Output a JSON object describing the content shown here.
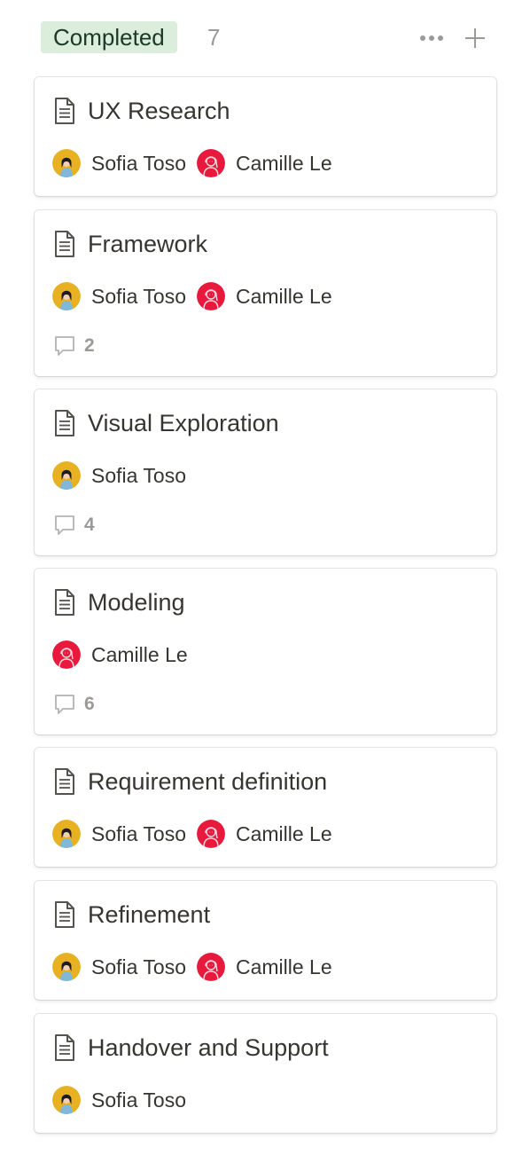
{
  "column": {
    "status_label": "Completed",
    "count": "7",
    "colors": {
      "pill_bg": "#dbeddb",
      "pill_text": "#1c3829",
      "muted": "#9b9a97"
    },
    "icons": {
      "more": "more-horizontal-icon",
      "add": "plus-icon"
    }
  },
  "people": {
    "sofia": {
      "name": "Sofia Toso",
      "avatar_color": "#e8b122"
    },
    "camille": {
      "name": "Camille Le",
      "avatar_color": "#e8193c"
    }
  },
  "cards": [
    {
      "title": "UX Research",
      "assignees": [
        "Sofia Toso",
        "Camille Le"
      ]
    },
    {
      "title": "Framework",
      "assignees": [
        "Sofia Toso",
        "Camille Le"
      ],
      "comments": "2"
    },
    {
      "title": "Visual Exploration",
      "assignees": [
        "Sofia Toso"
      ],
      "comments": "4"
    },
    {
      "title": "Modeling",
      "assignees": [
        "Camille Le"
      ],
      "comments": "6"
    },
    {
      "title": "Requirement definition",
      "assignees": [
        "Sofia Toso",
        "Camille Le"
      ]
    },
    {
      "title": "Refinement",
      "assignees": [
        "Sofia Toso",
        "Camille Le"
      ]
    },
    {
      "title": "Handover and Support",
      "assignees": [
        "Sofia Toso"
      ]
    }
  ]
}
